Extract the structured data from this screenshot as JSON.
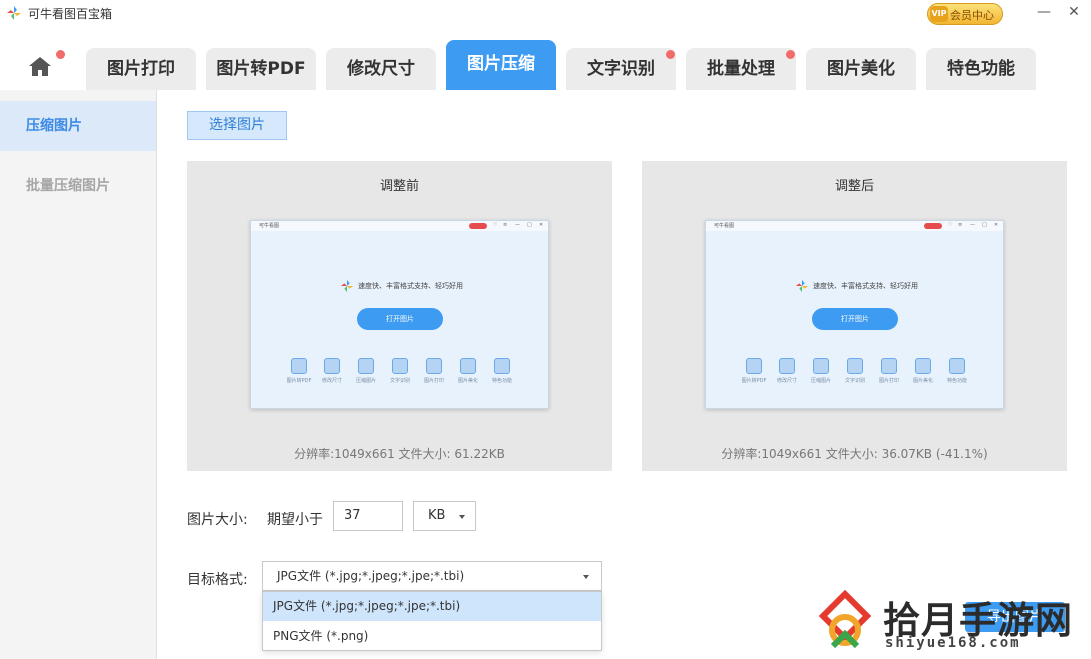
{
  "app": {
    "title": "可牛看图百宝箱",
    "vip_label": "会员中心",
    "vip_badge": "VIP"
  },
  "window": {
    "minimize": "—",
    "close": "✕"
  },
  "tabs": [
    {
      "label": "图片打印"
    },
    {
      "label": "图片转PDF"
    },
    {
      "label": "修改尺寸"
    },
    {
      "label": "图片压缩",
      "active": true
    },
    {
      "label": "文字识别"
    },
    {
      "label": "批量处理"
    },
    {
      "label": "图片美化"
    },
    {
      "label": "特色功能"
    }
  ],
  "sidebar": {
    "items": [
      {
        "label": "压缩图片",
        "active": true
      },
      {
        "label": "批量压缩图片"
      }
    ]
  },
  "main": {
    "select_button": "选择图片",
    "before": {
      "title": "调整前",
      "info": "分辨率:1049x661 文件大小: 61.22KB"
    },
    "after": {
      "title": "调整后",
      "info": "分辨率:1049x661 文件大小: 36.07KB (-41.1%)"
    },
    "preview": {
      "app_title": "可牛看图",
      "slogan": "速度快、丰富格式支持、轻巧好用",
      "open_button": "打开图片",
      "features": [
        "图片转PDF",
        "修改尺寸",
        "压缩图片",
        "文字识别",
        "图片打印",
        "图片美化",
        "特色功能"
      ]
    },
    "size": {
      "label": "图片大小:",
      "expect_label": "期望小于",
      "value": "37",
      "unit": "KB"
    },
    "format": {
      "label": "目标格式:",
      "selected": "JPG文件 (*.jpg;*.jpeg;*.jpe;*.tbi)",
      "options": [
        "JPG文件 (*.jpg;*.jpeg;*.jpe;*.tbi)",
        "PNG文件 (*.png)"
      ]
    },
    "export_button": "导出图片"
  },
  "watermark": {
    "text": "拾月手游网",
    "url": "shiyue168.com"
  },
  "colors": {
    "accent": "#3d9bf2",
    "badge_dot": "#f26b6b",
    "sidebar_active": "#dbe9f8"
  }
}
